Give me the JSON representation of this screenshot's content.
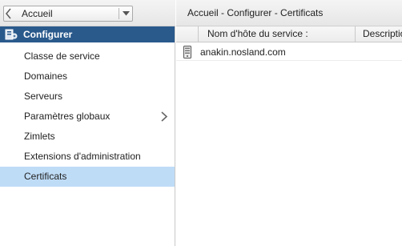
{
  "left": {
    "back_label": "Accueil",
    "section_title": "Configurer",
    "items": [
      {
        "label": "Classe de service"
      },
      {
        "label": "Domaines"
      },
      {
        "label": "Serveurs"
      },
      {
        "label": "Paramètres globaux",
        "has_submenu": true
      },
      {
        "label": "Zimlets"
      },
      {
        "label": "Extensions d'administration"
      },
      {
        "label": "Certificats",
        "selected": true
      }
    ]
  },
  "right": {
    "breadcrumb": "Accueil - Configurer - Certificats",
    "columns": {
      "host": "Nom d'hôte du service :",
      "description": "Description"
    },
    "rows": [
      {
        "host": "anakin.nosland.com",
        "icon": "server-icon"
      }
    ]
  },
  "colors": {
    "header_bg": "#2a5a8c",
    "selected_bg": "#bfdcf7"
  }
}
